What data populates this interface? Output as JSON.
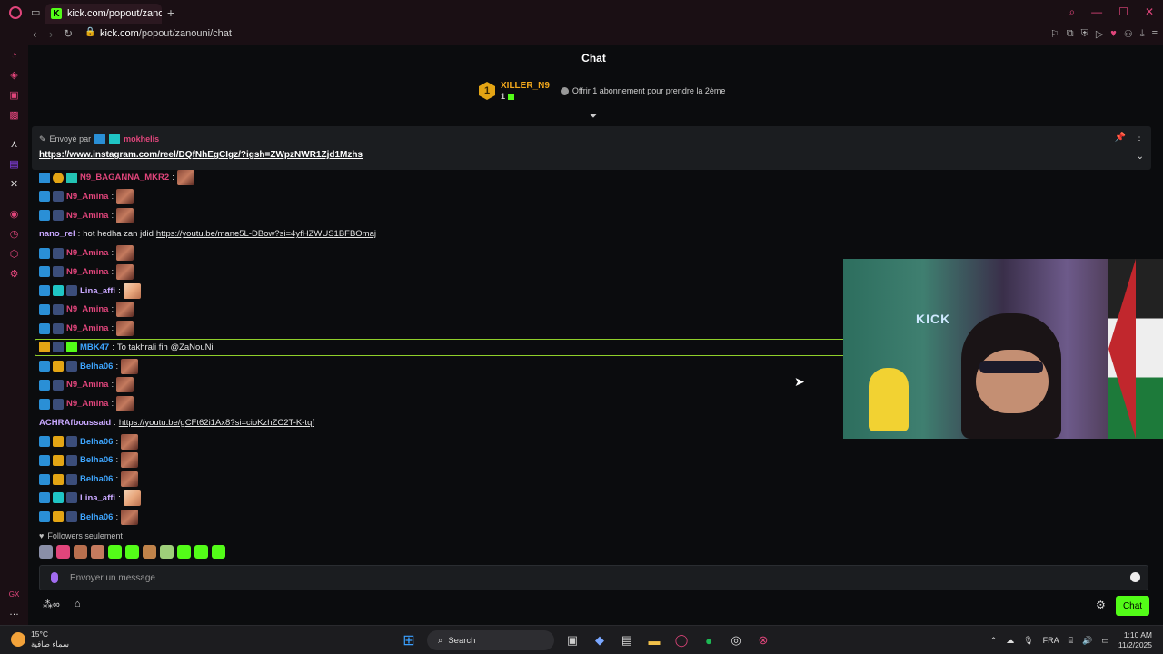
{
  "browser": {
    "tab_title": "kick.com/popout/zanouni",
    "url_host": "kick.com",
    "url_path": "/popout/zanouni/chat"
  },
  "chat": {
    "title": "Chat",
    "gifter": {
      "rank": "1",
      "name": "XILLER_N9",
      "count": "1"
    },
    "gift_offer": "Offrir 1 abonnement pour prendre la 2ème",
    "pinned": {
      "sent_by_label": "Envoyé par",
      "sent_by_name": "mokhelis",
      "link": "https://www.instagram.com/reel/DQfNhEgCIgz/?igsh=ZWpzNWR1Zjd1Mzhs"
    },
    "messages": [
      {
        "user": "N9_BAGANNA_MKR2",
        "color": "#e0457b",
        "badges": [
          "blue",
          "gold",
          "gift"
        ],
        "emote": "face",
        "text": ""
      },
      {
        "user": "N9_Amina",
        "color": "#e0457b",
        "badges": [
          "blue",
          "user"
        ],
        "emote": "face",
        "text": ""
      },
      {
        "user": "N9_Amina",
        "color": "#e0457b",
        "badges": [
          "blue",
          "user"
        ],
        "emote": "face",
        "text": ""
      },
      {
        "user": "nano_rel",
        "color": "#c9a8ff",
        "badges": [],
        "emote": "",
        "text": "hot hedha zan jdid",
        "link": "https://youtu.be/mane5L-DBow?si=4yfHZWUS1BFBOmaj"
      },
      {
        "user": "N9_Amina",
        "color": "#e0457b",
        "badges": [
          "blue",
          "user"
        ],
        "emote": "face",
        "text": ""
      },
      {
        "user": "N9_Amina",
        "color": "#e0457b",
        "badges": [
          "blue",
          "user"
        ],
        "emote": "face",
        "text": ""
      },
      {
        "user": "Lina_affi",
        "color": "#c9a8ff",
        "badges": [
          "blue",
          "teal",
          "user"
        ],
        "emote": "lina",
        "text": ""
      },
      {
        "user": "N9_Amina",
        "color": "#e0457b",
        "badges": [
          "blue",
          "user"
        ],
        "emote": "face",
        "text": ""
      },
      {
        "user": "N9_Amina",
        "color": "#e0457b",
        "badges": [
          "blue",
          "user"
        ],
        "emote": "face",
        "text": ""
      },
      {
        "user": "MBK47",
        "color": "#3ea6ff",
        "badges": [
          "crown",
          "user",
          "green"
        ],
        "emote": "",
        "text": "To takhrali fih @ZaNouNi",
        "highlight": true
      },
      {
        "user": "Belha06",
        "color": "#3ea6ff",
        "badges": [
          "blue",
          "crown",
          "user"
        ],
        "emote": "face",
        "text": ""
      },
      {
        "user": "N9_Amina",
        "color": "#e0457b",
        "badges": [
          "blue",
          "user"
        ],
        "emote": "face",
        "text": ""
      },
      {
        "user": "N9_Amina",
        "color": "#e0457b",
        "badges": [
          "blue",
          "user"
        ],
        "emote": "face",
        "text": ""
      },
      {
        "user": "ACHRAfboussaid",
        "color": "#c9a8ff",
        "badges": [],
        "emote": "",
        "text": "",
        "link": "https://youtu.be/gCFt62i1Ax8?si=cioKzhZC2T-K-tqf"
      },
      {
        "user": "Belha06",
        "color": "#3ea6ff",
        "badges": [
          "blue",
          "crown",
          "user"
        ],
        "emote": "face",
        "text": ""
      },
      {
        "user": "Belha06",
        "color": "#3ea6ff",
        "badges": [
          "blue",
          "crown",
          "user"
        ],
        "emote": "face",
        "text": ""
      },
      {
        "user": "Belha06",
        "color": "#3ea6ff",
        "badges": [
          "blue",
          "crown",
          "user"
        ],
        "emote": "face",
        "text": ""
      },
      {
        "user": "Lina_affi",
        "color": "#c9a8ff",
        "badges": [
          "blue",
          "teal",
          "user"
        ],
        "emote": "lina",
        "text": ""
      },
      {
        "user": "Belha06",
        "color": "#3ea6ff",
        "badges": [
          "blue",
          "crown",
          "user"
        ],
        "emote": "face",
        "text": ""
      }
    ],
    "followers_label": "Followers seulement",
    "input_placeholder": "Envoyer un message",
    "send_label": "Chat",
    "webcam_sign": "KICK"
  },
  "taskbar": {
    "temperature": "15°C",
    "weather_desc": "سماء صافية",
    "search_label": "Search",
    "language": "FRA",
    "time": "1:10 AM",
    "date": "11/2/2025"
  },
  "colors": {
    "accent": "#53fc18",
    "opera": "#e0457b"
  }
}
